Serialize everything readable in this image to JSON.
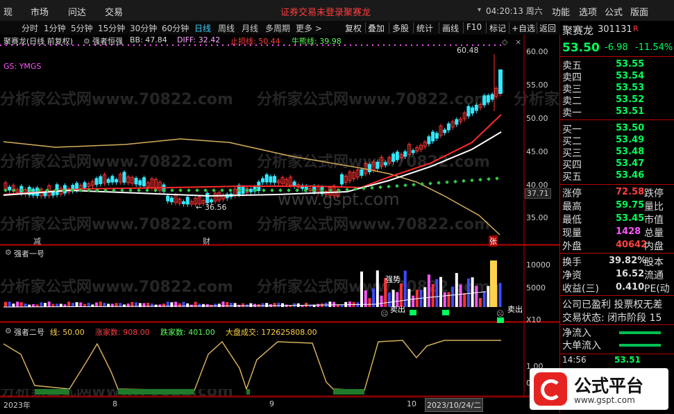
{
  "menubar": {
    "left_item": "现",
    "items": [
      "市场",
      "问达",
      "交易"
    ],
    "notice": "证券交易未登录",
    "stock_link": "聚赛龙",
    "time": "04:20:13 周六",
    "right_items": [
      "功能",
      "选项",
      "公式",
      "版面"
    ]
  },
  "periods": [
    "分时",
    "1分钟",
    "5分钟",
    "15分钟",
    "30分钟",
    "60分钟",
    "日线",
    "周线",
    "月线",
    "多周期",
    "更多 >"
  ],
  "active_period": "日线",
  "toolbar": [
    "复权",
    "叠加",
    "多股",
    "统计",
    "画线",
    "F10",
    "标记",
    "+自选",
    "返回"
  ],
  "main_chart": {
    "title": "聚赛龙(日线 前复权)",
    "indicator_name": "强者恒强",
    "bb": "BB: 47.84",
    "diff": "DIFF: 32.42",
    "stop_loss": "止损线: 50.44",
    "bull_line": "牛熊线: 39.98",
    "gs_label": "GS: YMGS",
    "high_marker": "60.48",
    "low_marker": "36.56",
    "cursor_price": "37.71",
    "y_ticks": [
      "60.00",
      "55.00",
      "50.00",
      "45.00",
      "40.00",
      "35.00"
    ],
    "events": [
      "减",
      "财",
      "张"
    ]
  },
  "sub1": {
    "title": "强者一号",
    "y_ticks": [
      "10000",
      "5000"
    ],
    "ann_strong": "强势",
    "ann_sell1": "卖出",
    "ann_sell2": "卖出",
    "scale": "X10"
  },
  "sub2": {
    "title": "强者二号",
    "line": "线: 50.00",
    "up_count": "涨家数: 908.00",
    "down_count": "跌家数: 401.00",
    "market_vol": "大盘成交: 172625808.00",
    "y_ticks": [
      "1.00",
      "0.00"
    ]
  },
  "x_axis": {
    "labels": [
      "2023年",
      "8",
      "9",
      "10"
    ],
    "current_date": "2023/10/24/二"
  },
  "quote": {
    "name": "聚赛龙",
    "code": "301131",
    "r_badge": "R",
    "price": "53.50",
    "change": "-6.98",
    "change_pct": "-11.54%",
    "asks": [
      {
        "label": "卖五",
        "price": "53.55"
      },
      {
        "label": "卖四",
        "price": "53.54"
      },
      {
        "label": "卖三",
        "price": "53.53"
      },
      {
        "label": "卖二",
        "price": "53.52"
      },
      {
        "label": "卖一",
        "price": "53.51"
      }
    ],
    "bids": [
      {
        "label": "买一",
        "price": "53.50"
      },
      {
        "label": "买二",
        "price": "53.49"
      },
      {
        "label": "买三",
        "price": "53.48"
      },
      {
        "label": "买四",
        "price": "53.47"
      },
      {
        "label": "买五",
        "price": "53.46"
      }
    ],
    "stats": [
      {
        "label": "涨停",
        "value": "72.58",
        "label2": "跌停"
      },
      {
        "label": "最高",
        "value": "59.75",
        "label2": "量比"
      },
      {
        "label": "最低",
        "value": "53.45",
        "label2": "市值"
      },
      {
        "label": "现量",
        "value": "1428",
        "label2": "总量"
      },
      {
        "label": "外盘",
        "value": "40642",
        "label2": "内盘"
      }
    ],
    "stats2": [
      {
        "label": "换手",
        "value": "39.82%",
        "label2": "股本"
      },
      {
        "label": "净资",
        "value": "16.52",
        "label2": "流通"
      },
      {
        "label": "收益(三)",
        "value": "0.410",
        "label2": "PE(动"
      }
    ],
    "company_note": "公司已盈利 投票权无差",
    "trade_status": "交易状态: 闭市阶段 15",
    "net_inflow": "净流入",
    "big_inflow": "大单流入",
    "trade_time": "14:56",
    "trade_price": "53.51"
  },
  "watermarks": [
    "分析家公式网www.70822.com",
    "www.gspt.com"
  ],
  "logo": {
    "text": "公式平台",
    "url": "www.gspt.com"
  },
  "colors": {
    "up": "#ff3232",
    "down": "#00ff5a",
    "accent": "#3ad1ff",
    "bg": "#000000"
  }
}
